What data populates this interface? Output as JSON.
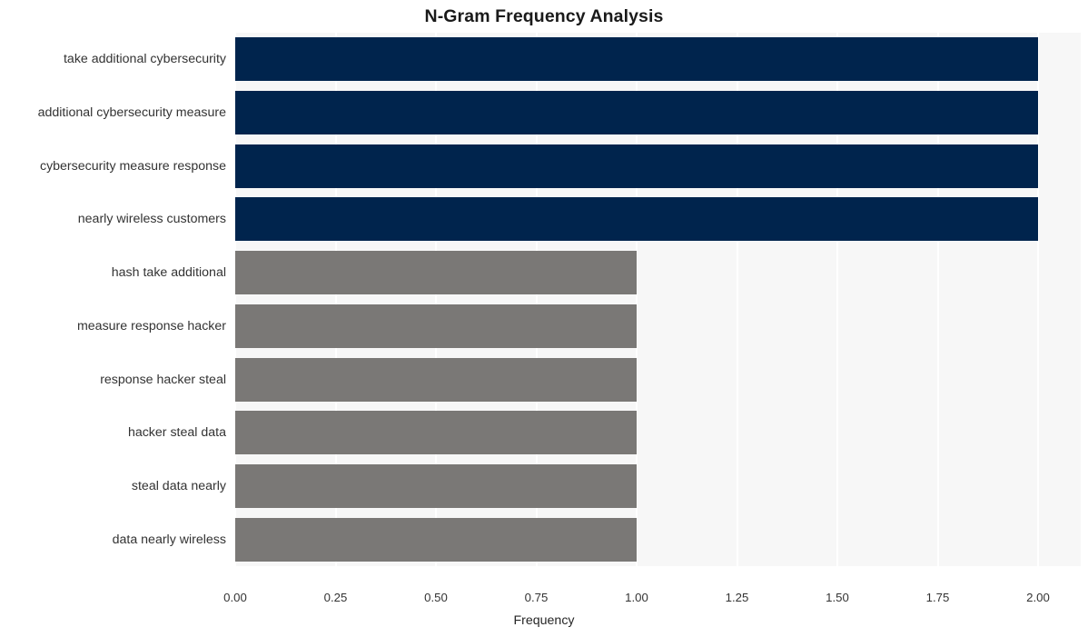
{
  "chart_data": {
    "type": "bar",
    "orientation": "horizontal",
    "title": "N-Gram Frequency Analysis",
    "xlabel": "Frequency",
    "ylabel": "",
    "xlim": [
      0,
      2.0
    ],
    "xticks": [
      "0.00",
      "0.25",
      "0.50",
      "0.75",
      "1.00",
      "1.25",
      "1.50",
      "1.75",
      "2.00"
    ],
    "xtick_values": [
      0,
      0.25,
      0.5,
      0.75,
      1.0,
      1.25,
      1.5,
      1.75,
      2.0
    ],
    "grid": true,
    "grid_axis": "x",
    "legend": "none",
    "categories": [
      "take additional cybersecurity",
      "additional cybersecurity measure",
      "cybersecurity measure response",
      "nearly wireless customers",
      "hash take additional",
      "measure response hacker",
      "response hacker steal",
      "hacker steal data",
      "steal data nearly",
      "data nearly wireless"
    ],
    "values": [
      2,
      2,
      2,
      2,
      1,
      1,
      1,
      1,
      1,
      1
    ],
    "bar_colors": [
      "#00244d",
      "#00244d",
      "#00244d",
      "#00244d",
      "#7a7876",
      "#7a7876",
      "#7a7876",
      "#7a7876",
      "#7a7876",
      "#7a7876"
    ],
    "plot_background": "#f7f7f7",
    "grid_color": "#ffffff",
    "figure_background": "#ffffff"
  }
}
